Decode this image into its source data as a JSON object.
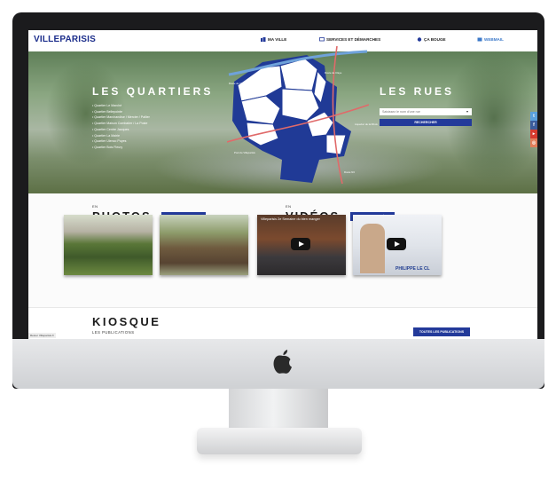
{
  "site": {
    "logo": "VILLEPARISIS",
    "nav": [
      {
        "label": "MA VILLE",
        "icon": "city-icon"
      },
      {
        "label": "SERVICES ET DÉMARCHES",
        "icon": "services-icon"
      },
      {
        "label": "ÇA BOUGE",
        "icon": "events-icon"
      },
      {
        "label": "WEBMAIL",
        "icon": "webmail-icon"
      }
    ]
  },
  "hero": {
    "quartiers_title": "LES QUARTIERS",
    "quartiers": [
      "Quartier Le Marché",
      "Quartier Bellepointe",
      "Quartier Marchandise / Mercier / Pallier",
      "Quartier Maison Combalier / La Poste",
      "Quartier Centre Jacques",
      "Quartier La Mairie",
      "Quartier Ulenco Poyes",
      "Quartier Bois Fleury"
    ],
    "rues_title": "LES RUES",
    "street_placeholder": "Saisissez le nom d'une rue",
    "search_label": "RECHERCHER",
    "map_labels": [
      "Route de Claye",
      "Route de Claye",
      "Aqueduc de la Dhuis",
      "Pont de Villeparisis",
      "Route N3"
    ]
  },
  "media": {
    "photos_prefix": "EN",
    "photos_title": "PHOTOS",
    "photos_button": "TOUTES LES PHOTOS",
    "videos_prefix": "EN",
    "videos_title": "VIDÉOS",
    "videos_button": "TOUTES LES VIDÉOS",
    "video1_caption": "Villeparisis 2e Semaine du bien manger",
    "video2_caption": "PHILIPPE LE CL"
  },
  "kiosque": {
    "title": "KIOSQUE",
    "subtitle": "LES PUBLICATIONS",
    "button": "TOUTES LES PUBLICATIONS"
  },
  "social": [
    "twitter-icon",
    "facebook-icon",
    "youtube-icon",
    "instagram-icon"
  ],
  "status": "Retour Villeparisis.fr",
  "colors": {
    "brand": "#233a9a",
    "accent": "#3c79c9",
    "map_fill": "#203a96"
  }
}
